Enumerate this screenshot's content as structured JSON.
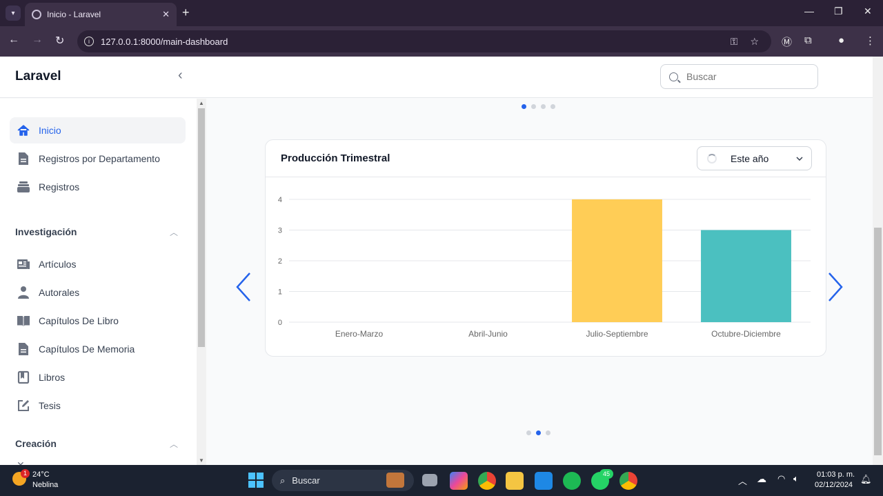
{
  "browser": {
    "tab_title": "Inicio - Laravel",
    "url": "127.0.0.1:8000/main-dashboard"
  },
  "app": {
    "brand": "Laravel",
    "search_placeholder": "Buscar"
  },
  "sidebar": {
    "items": [
      {
        "label": "Inicio",
        "icon": "home-icon",
        "active": true
      },
      {
        "label": "Registros por Departamento",
        "icon": "document-icon"
      },
      {
        "label": "Registros",
        "icon": "stack-icon"
      }
    ],
    "groups": [
      {
        "title": "Investigación",
        "items": [
          {
            "label": "Artículos",
            "icon": "newspaper-icon"
          },
          {
            "label": "Autorales",
            "icon": "user-icon"
          },
          {
            "label": "Capítulos De Libro",
            "icon": "open-book-icon"
          },
          {
            "label": "Capítulos De Memoria",
            "icon": "document-icon"
          },
          {
            "label": "Libros",
            "icon": "bookmark-icon"
          },
          {
            "label": "Tesis",
            "icon": "pencil-square-icon"
          }
        ]
      },
      {
        "title": "Creación",
        "items": []
      }
    ]
  },
  "card": {
    "title": "Producción Trimestral",
    "filter": "Este año"
  },
  "chart_data": {
    "type": "bar",
    "title": "Producción Trimestral",
    "categories": [
      "Enero-Marzo",
      "Abril-Junio",
      "Julio-Septiembre",
      "Octubre-Diciembre"
    ],
    "values": [
      0,
      0,
      4,
      3
    ],
    "colors": [
      "#ff6384",
      "#36a2eb",
      "#ffcd56",
      "#4bc0c0"
    ],
    "ylim": [
      0,
      4
    ],
    "yticks": [
      0,
      1,
      2,
      3,
      4
    ],
    "grid": true
  },
  "taskbar": {
    "weather_temp": "24°C",
    "weather_desc": "Neblina",
    "weather_badge": "1",
    "search_label": "Buscar",
    "whatsapp_badge": "45",
    "time": "01:03 p. m.",
    "date": "02/12/2024"
  }
}
